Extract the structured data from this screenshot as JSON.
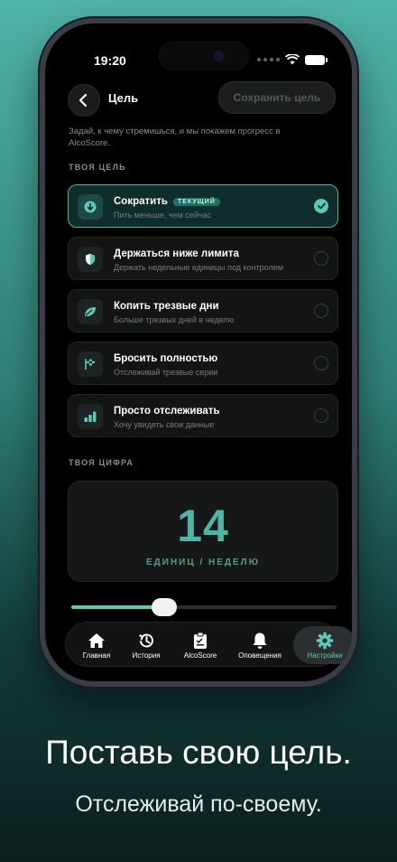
{
  "status": {
    "time": "19:20"
  },
  "header": {
    "title": "Цель",
    "save_label": "Сохранить цель"
  },
  "intro": "Задай, к чему стремишься, и мы покажем прогресс в AlcoScore.",
  "goal_section_label": "ТВОЯ ЦЕЛЬ",
  "goals": [
    {
      "title": "Сократить",
      "subtitle": "Пить меньше, чем сейчас",
      "badge": "ТЕКУЩИЙ",
      "selected": true,
      "icon": "down-arrow-icon"
    },
    {
      "title": "Держаться ниже лимита",
      "subtitle": "Держать недельные единицы под контролем",
      "selected": false,
      "icon": "shield-icon"
    },
    {
      "title": "Копить трезвые дни",
      "subtitle": "Больше трезвых дней в неделю",
      "selected": false,
      "icon": "leaf-icon"
    },
    {
      "title": "Бросить полностью",
      "subtitle": "Отслеживай трезвые серии",
      "selected": false,
      "icon": "flag-icon"
    },
    {
      "title": "Просто отслеживать",
      "subtitle": "Хочу увидеть свои данные",
      "selected": false,
      "icon": "bars-icon"
    }
  ],
  "number_section_label": "ТВОЯ ЦИФРА",
  "target": {
    "value": "14",
    "unit": "ЕДИНИЦ / НЕДЕЛЮ",
    "slider_fraction": 0.35
  },
  "tabs": [
    {
      "label": "Главная",
      "icon": "home-icon",
      "active": false
    },
    {
      "label": "История",
      "icon": "history-icon",
      "active": false
    },
    {
      "label": "AlcoScore",
      "icon": "clipboard-icon",
      "active": false
    },
    {
      "label": "Оповещения",
      "icon": "bell-icon",
      "active": false
    },
    {
      "label": "Настройки",
      "icon": "gear-icon",
      "active": true
    }
  ],
  "promo": {
    "headline": "Поставь свою цель.",
    "subline": "Отслеживай по-своему."
  },
  "colors": {
    "accent": "#4fb3a6",
    "accent_light": "#5ec8ba",
    "background": "#000000"
  }
}
